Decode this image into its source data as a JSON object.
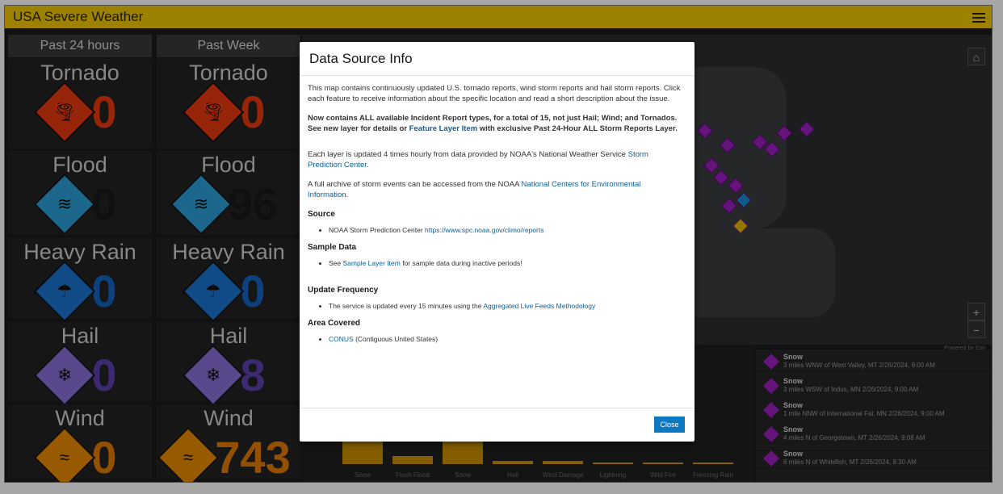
{
  "header": {
    "title": "USA Severe Weather"
  },
  "columns": [
    {
      "title": "Past 24 hours",
      "cards": [
        {
          "label": "Tornado",
          "count": "0",
          "color": "#e8390e",
          "icon": "tornado-icon"
        },
        {
          "label": "Flood",
          "count": "0",
          "color": "#1a1a1a",
          "icon": "flood-icon"
        },
        {
          "label": "Heavy Rain",
          "count": "0",
          "color": "#1565c0",
          "icon": "rain-icon"
        },
        {
          "label": "Hail",
          "count": "0",
          "color": "#5b3fb0",
          "icon": "hail-icon"
        },
        {
          "label": "Wind",
          "count": "0",
          "color": "#e07b00",
          "icon": "wind-icon"
        }
      ]
    },
    {
      "title": "Past Week",
      "cards": [
        {
          "label": "Tornado",
          "count": "0",
          "color": "#e8390e",
          "icon": "tornado-icon"
        },
        {
          "label": "Flood",
          "count": "96",
          "color": "#1a1a1a",
          "icon": "flood-icon"
        },
        {
          "label": "Heavy Rain",
          "count": "0",
          "color": "#1565c0",
          "icon": "rain-icon"
        },
        {
          "label": "Hail",
          "count": "8",
          "color": "#5b3fb0",
          "icon": "hail-icon"
        },
        {
          "label": "Wind",
          "count": "743",
          "color": "#e07b00",
          "icon": "wind-icon"
        }
      ]
    }
  ],
  "chart": {
    "labels": [
      "Snow",
      "Flash Flood",
      "Snow",
      "Hail",
      "Wind Damage",
      "Lightning",
      "Wild Fire",
      "Freezing Rain"
    ]
  },
  "feed": [
    {
      "type": "Snow",
      "text": "3 miles WNW of West Valley, MT 2/26/2024, 9:00 AM"
    },
    {
      "type": "Snow",
      "text": "3 miles WSW of Indus, MN 2/26/2024, 9:00 AM"
    },
    {
      "type": "Snow",
      "text": "1 mile NNW of International Fal, MN 2/26/2024, 9:00 AM"
    },
    {
      "type": "Snow",
      "text": "4 miles N of Georgetown, MT 2/26/2024, 9:08 AM"
    },
    {
      "type": "Snow",
      "text": "6 miles N of Whitefish, MT 2/26/2024, 8:30 AM"
    }
  ],
  "map": {
    "attribution": "Powered by Esri",
    "zoom_in": "+",
    "zoom_out": "−"
  },
  "modal": {
    "title": "Data Source Info",
    "p1": "This map contains continuously updated U.S. tornado reports, wind storm reports and hail storm reports. Click each feature to receive information about the specific location and read a short description about the issue.",
    "bold1": "Now contains ALL available Incident Report types, for a total of 15, not just Hail; Wind; and Tornados.",
    "bold2a": "See new layer for details or ",
    "bold2link": "Feature Layer Item",
    "bold2b": " with exclusive Past 24-Hour ALL Storm Reports Layer.",
    "p3a": "Each layer is updated 4 times hourly from data provided by NOAA's National Weather Service ",
    "p3link": "Storm Prediction Center",
    "p3b": ".",
    "p4a": "A full archive of storm events can be accessed from the NOAA ",
    "p4link": "National Centers for Environmental Information",
    "p4b": ".",
    "source_h": "Source",
    "source_a": "NOAA Storm Prediction Center ",
    "source_link": "https://www.spc.noaa.gov/climo/reports",
    "sample_h": "Sample Data",
    "sample_a": "See ",
    "sample_link": "Sample Layer Item",
    "sample_b": " for sample data during inactive periods!",
    "update_h": "Update Frequency",
    "update_a": "The service is updated every 15 minutes using the ",
    "update_link": "Aggregated Live Feeds Methodology",
    "area_h": "Area Covered",
    "area_link": "CONUS",
    "area_b": " (Contiguous United States)",
    "close_label": "Close"
  }
}
